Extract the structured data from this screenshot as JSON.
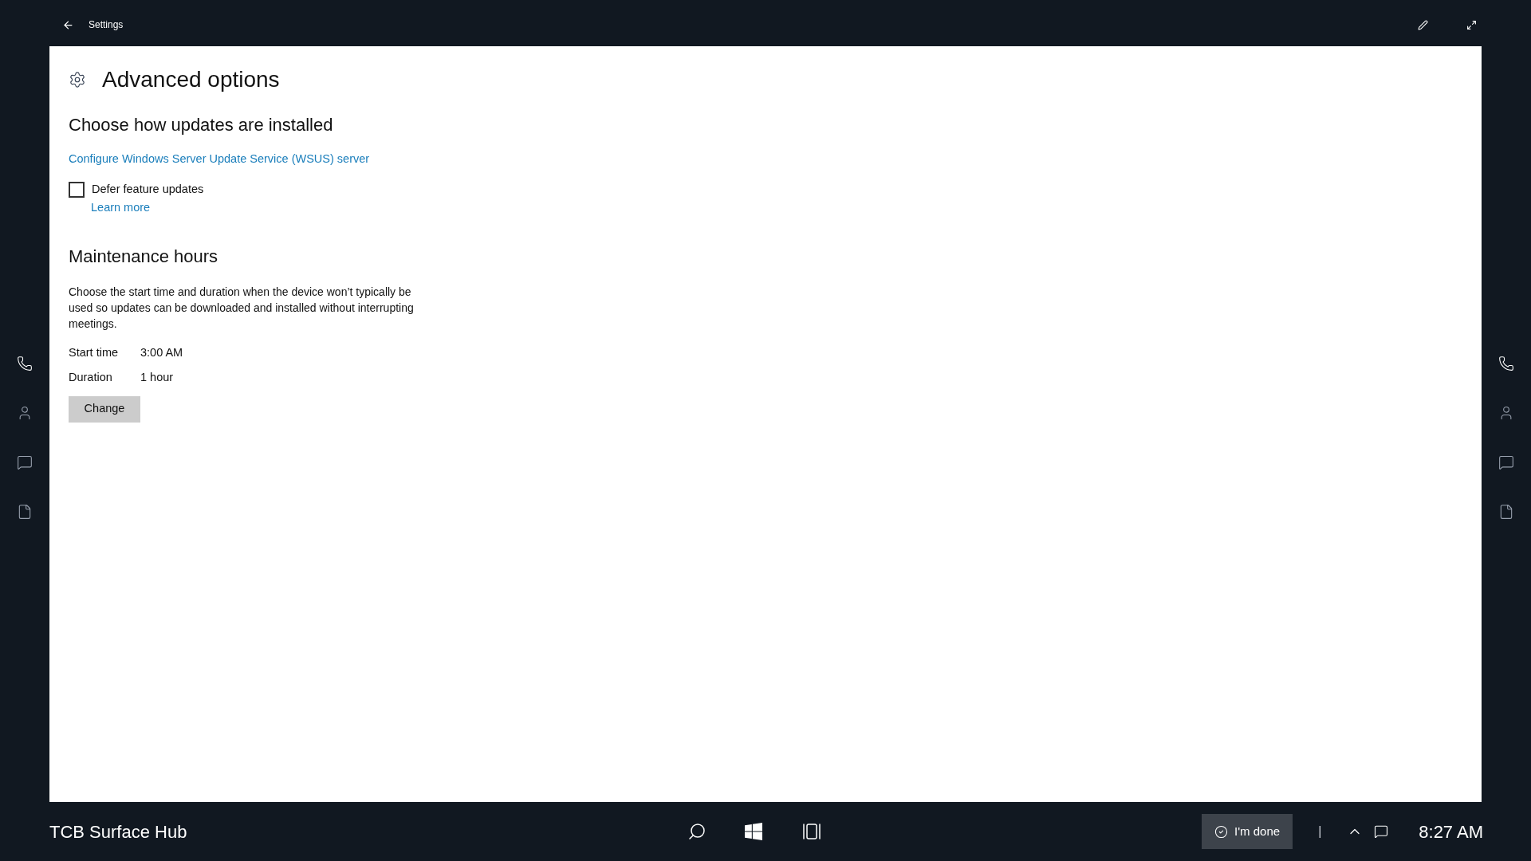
{
  "window": {
    "title": "Settings"
  },
  "page": {
    "title": "Advanced options"
  },
  "updates": {
    "heading": "Choose how updates are installed",
    "link": "Configure Windows Server Update Service (WSUS) server",
    "defer": {
      "label": "Defer feature updates",
      "checked": false
    },
    "learn_more": "Learn more"
  },
  "maintenance": {
    "heading": "Maintenance hours",
    "description": "Choose the start time and duration when the device won’t typically be used so updates can be downloaded and installed without interrupting meetings.",
    "fields": [
      {
        "label": "Start time",
        "value": "3:00 AM"
      },
      {
        "label": "Duration",
        "value": "1 hour"
      }
    ],
    "button": "Change"
  },
  "taskbar": {
    "device_name": "TCB Surface Hub",
    "done_button": "I'm done",
    "separator": "|",
    "time": "8:27 AM"
  }
}
